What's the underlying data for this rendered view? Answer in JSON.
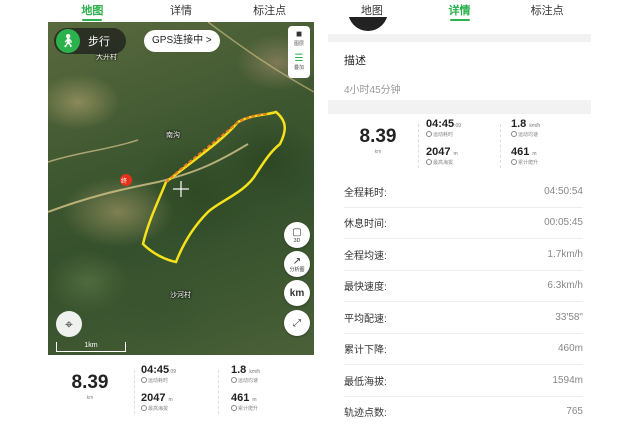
{
  "tabs": [
    "地图",
    "详情",
    "标注点"
  ],
  "map": {
    "mode_label": "步行",
    "gps_label": "GPS连接中 >",
    "layer_label": "图层",
    "overlay_label": "叠加",
    "btn_3d_label": "3D",
    "btn_analysis_label": "分析图",
    "btn_km_label": "km",
    "scale_label": "1km",
    "place_labels": [
      "大开村",
      "南沟",
      "沙河村"
    ],
    "end_marker": "终"
  },
  "stats": {
    "distance": "8.39",
    "distance_unit": "km",
    "moving_time": "04:45",
    "moving_time_sec": ":09",
    "moving_time_desc": "运动耗时",
    "avg_speed": "1.8",
    "avg_speed_unit": "km/h",
    "avg_speed_desc": "运动均速",
    "max_alt": "2047",
    "max_alt_unit": "m",
    "max_alt_desc": "最高海拔",
    "climb": "461",
    "climb_unit": "m",
    "climb_desc": "累计爬升"
  },
  "detail": {
    "desc_title": "描述",
    "desc_text": "4小时45分钟",
    "rows": [
      {
        "k": "全程耗时:",
        "v": "04:50:54"
      },
      {
        "k": "休息时间:",
        "v": "00:05:45"
      },
      {
        "k": "全程均速:",
        "v": "1.7km/h"
      },
      {
        "k": "最快速度:",
        "v": "6.3km/h"
      },
      {
        "k": "平均配速:",
        "v": "33'58\""
      },
      {
        "k": "累计下降:",
        "v": "460m"
      },
      {
        "k": "最低海拔:",
        "v": "1594m"
      },
      {
        "k": "轨迹点数:",
        "v": "765"
      }
    ]
  },
  "colors": {
    "accent": "#2bb24c",
    "track": "#f5e21a",
    "track_alt": "#f07b1e"
  }
}
